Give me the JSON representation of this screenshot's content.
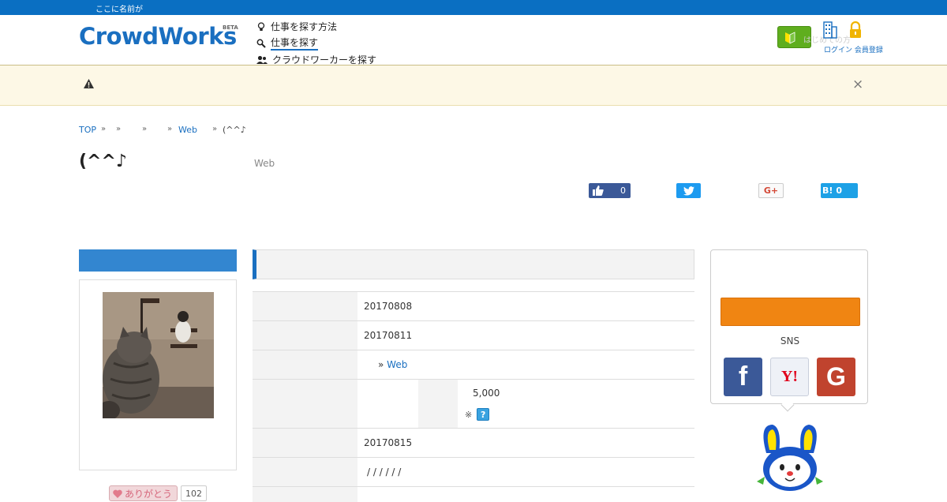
{
  "topbar": {
    "text": "ここに名前が"
  },
  "header": {
    "logo": "CrowdWorks",
    "logo_badge": "BETA",
    "nav": [
      {
        "label": "仕事を探す方法"
      },
      {
        "label": "仕事を探す"
      },
      {
        "label": "クラウドワーカーを探す"
      }
    ],
    "beginner_button_ghost": "はじめての方",
    "right_links": "ログイン 会員登録"
  },
  "notice": {
    "close": "×"
  },
  "breadcrumb": [
    {
      "label": "TOP"
    },
    {
      "label": "Web"
    },
    {
      "label": "(^^♪"
    }
  ],
  "job": {
    "title": "(^^♪",
    "category": "Web"
  },
  "share": {
    "like_count": "0",
    "googleplus": "G+",
    "hatena": "B!",
    "hatena_count": "0"
  },
  "details": {
    "published": "20170808",
    "deadline": "20170811",
    "category_prefix": "»",
    "category_link": "Web",
    "reward_amount": "5,000",
    "reward_note": "※",
    "help_icon": "?",
    "delivery": "20170815",
    "slashes": "/ / / / / /"
  },
  "sidebar": {
    "thanks_label": "ありがとう",
    "thanks_count": "102"
  },
  "apply": {
    "sns_label": "SNS"
  },
  "colors": {
    "brand_blue": "#1a6fc0",
    "apply_orange": "#f08512",
    "beginner_green": "#5fae1e"
  }
}
